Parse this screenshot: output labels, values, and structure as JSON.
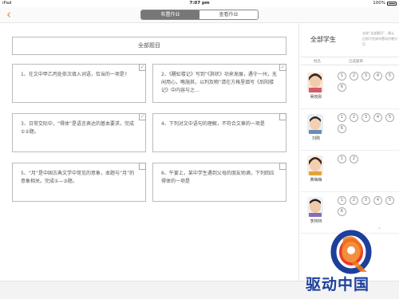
{
  "status_bar": {
    "device": "iPad",
    "time": "7:07 pm",
    "battery": "100%"
  },
  "nav": {
    "back_icon": "chevron-left-icon",
    "tabs": [
      {
        "label": "布置作业",
        "active": true
      },
      {
        "label": "查看作业",
        "active": false
      }
    ]
  },
  "left": {
    "all_questions": "全部题目",
    "questions": [
      {
        "text": "1、在文中甲乙丙处依次填入词语，恰当的一项是?",
        "checked": true
      },
      {
        "text": "2、《醒虹楼记》写到“《滁状》功来发展，遇守一州，无闲用心，略施其，以判及物”请在方格里填写《后阳楼记》中内容与之…",
        "checked": true
      },
      {
        "text": "3、日常交际中，“得体”是语言表达的基本要求，完成①②题。",
        "checked": true
      },
      {
        "text": "4、下列对文中语句的理解，不符合文章的一项是",
        "checked": false
      },
      {
        "text": "5、“月”是中国古典文学中常见的意象，本题与“月”的意象相关。完成①—③题。",
        "checked": false
      },
      {
        "text": "6、午宴上，某中学生遇到父母的朋友劝酒，下列回应得体的一项是",
        "checked": false
      }
    ]
  },
  "right": {
    "title": "全部学生",
    "desc": "长按“全部题目”，确认后即可完成布置动作哪分页",
    "col_name": "姓名",
    "col_selected": "已选题目",
    "students": [
      {
        "name": "吴晓彤",
        "selected": [
          "1",
          "2",
          "3",
          "4",
          "5",
          "6"
        ]
      },
      {
        "name": "刘刚",
        "selected": [
          "1",
          "2",
          "3",
          "4",
          "5",
          "6"
        ]
      },
      {
        "name": "黄梅梅",
        "selected": [
          "1",
          "2"
        ]
      },
      {
        "name": "李林林",
        "selected": [
          "1",
          "2",
          "3",
          "4",
          "5",
          "6"
        ]
      }
    ],
    "more_icon": "chevron-down-icon"
  },
  "watermark": {
    "text": "驱动中国"
  },
  "colors": {
    "accent": "#f08c1e",
    "check": "#6bbf8a",
    "brand_blue": "#1d3f9c",
    "brand_orange": "#f07a1a"
  }
}
